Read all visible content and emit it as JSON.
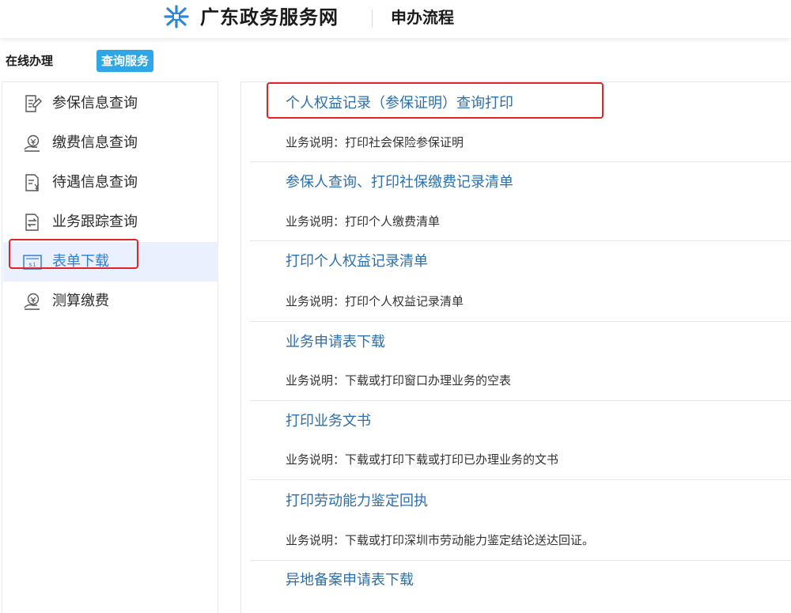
{
  "header": {
    "site_name": "广东政务服务网",
    "section": "申办流程"
  },
  "tabs": {
    "online": "在线办理",
    "query": "查询服务"
  },
  "sidebar": {
    "items": [
      {
        "label": "参保信息查询",
        "icon": "edit-document-icon"
      },
      {
        "label": "缴费信息查询",
        "icon": "payment-hand-icon"
      },
      {
        "label": "待遇信息查询",
        "icon": "yen-document-icon"
      },
      {
        "label": "业务跟踪查询",
        "icon": "exchange-document-icon"
      },
      {
        "label": "表单下载",
        "icon": "si-card-icon",
        "active": true
      },
      {
        "label": "测算缴费",
        "icon": "payment-hand-icon"
      }
    ]
  },
  "services": [
    {
      "title": "个人权益记录（参保证明）查询打印",
      "desc": "业务说明：打印社会保险参保证明"
    },
    {
      "title": "参保人查询、打印社保缴费记录清单",
      "desc": "业务说明：打印个人缴费清单"
    },
    {
      "title": "打印个人权益记录清单",
      "desc": "业务说明：打印个人权益记录清单"
    },
    {
      "title": "业务申请表下载",
      "desc": "业务说明：下载或打印窗口办理业务的空表"
    },
    {
      "title": "打印业务文书",
      "desc": "业务说明：下载或打印下载或打印已办理业务的文书"
    },
    {
      "title": "打印劳动能力鉴定回执",
      "desc": "业务说明：下载或打印深圳市劳动能力鉴定结论送达回证。"
    },
    {
      "title": "异地备案申请表下载",
      "desc": ""
    }
  ],
  "colors": {
    "accent": "#2fa6e6",
    "link": "#2b6fae",
    "active_bg": "#eaf0fd",
    "active_text": "#2f7fd8",
    "highlight": "#e0242a"
  }
}
